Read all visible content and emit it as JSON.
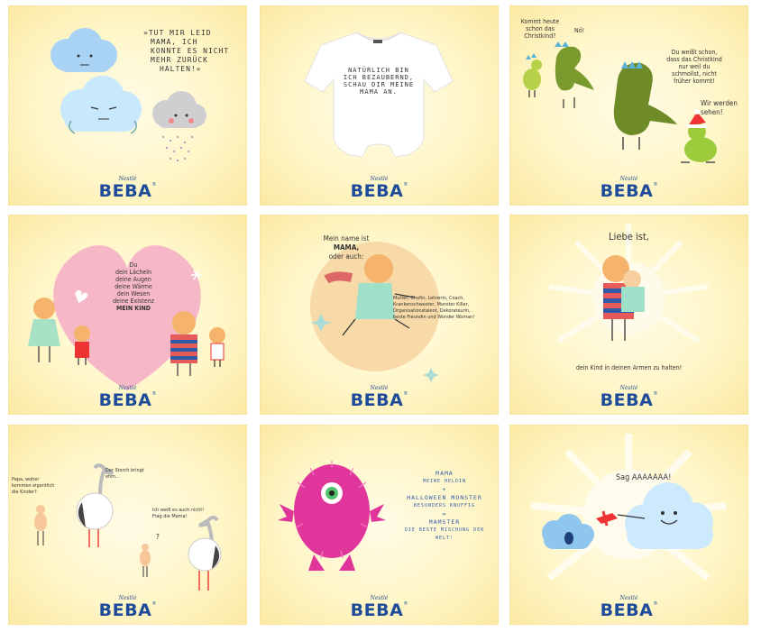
{
  "brand": {
    "nestle": "Nestlé",
    "beba": "BEBA",
    "reg": "®"
  },
  "cards": [
    {
      "lines": [
        "»TUT MIR LEID",
        "MAMA, ICH",
        "KONNTE ES NICHT",
        "MEHR ZURÜCK",
        "HALTEN!«"
      ]
    },
    {
      "lines": [
        "NATÜRLICH BIN",
        "ICH BEZAUBERND,",
        "SCHAU DIR MEINE",
        "MAMA AN."
      ]
    },
    {
      "q1": [
        "Kommt heute",
        "schon das",
        "Christkind?"
      ],
      "q2": "Nö!",
      "q3": [
        "Du weißt schon,",
        "dass das Christkind",
        "nur weil du",
        "schmollst, nicht",
        "früher kommt!"
      ],
      "q4": [
        "Wir werden",
        "sehen!"
      ]
    },
    {
      "lines": [
        "Du",
        "dein Lächeln",
        "deine Augen",
        "deine Wärme",
        "dein Wesen",
        "deine Existenz",
        "MEIN KIND"
      ]
    },
    {
      "title": [
        "Mein name ist",
        "MAMA,",
        "oder auch:"
      ],
      "body": [
        "Mutter, Chefin, Lehrerin, Coach,",
        "Krankenschwester, Monster Killer,",
        "Organisationstalent, Dekorateurin,",
        "beste Freundin und Wonder Woman!"
      ]
    },
    {
      "title": "Liebe ist,",
      "caption": "dein Kind in deinen Armen zu halten!"
    },
    {
      "q1": [
        "Papa, woher",
        "kommen eigentlich",
        "die Kinder?"
      ],
      "q2": [
        "Der Storch bringt",
        "ehm..."
      ],
      "q3": [
        "Ich weiß es auch nicht!",
        "Frag die Mama!"
      ],
      "q4": "?"
    },
    {
      "lines": [
        "MAMA",
        "MEINE HELDIN",
        "+",
        "HALLOWEEN MONSTER",
        "BESONDERS KNUFFIG",
        "=",
        "MAMSTER",
        "DIE BESTE MISCHUNG DER WELT!"
      ]
    },
    {
      "speech": "Sag AAAAAAA!"
    }
  ]
}
